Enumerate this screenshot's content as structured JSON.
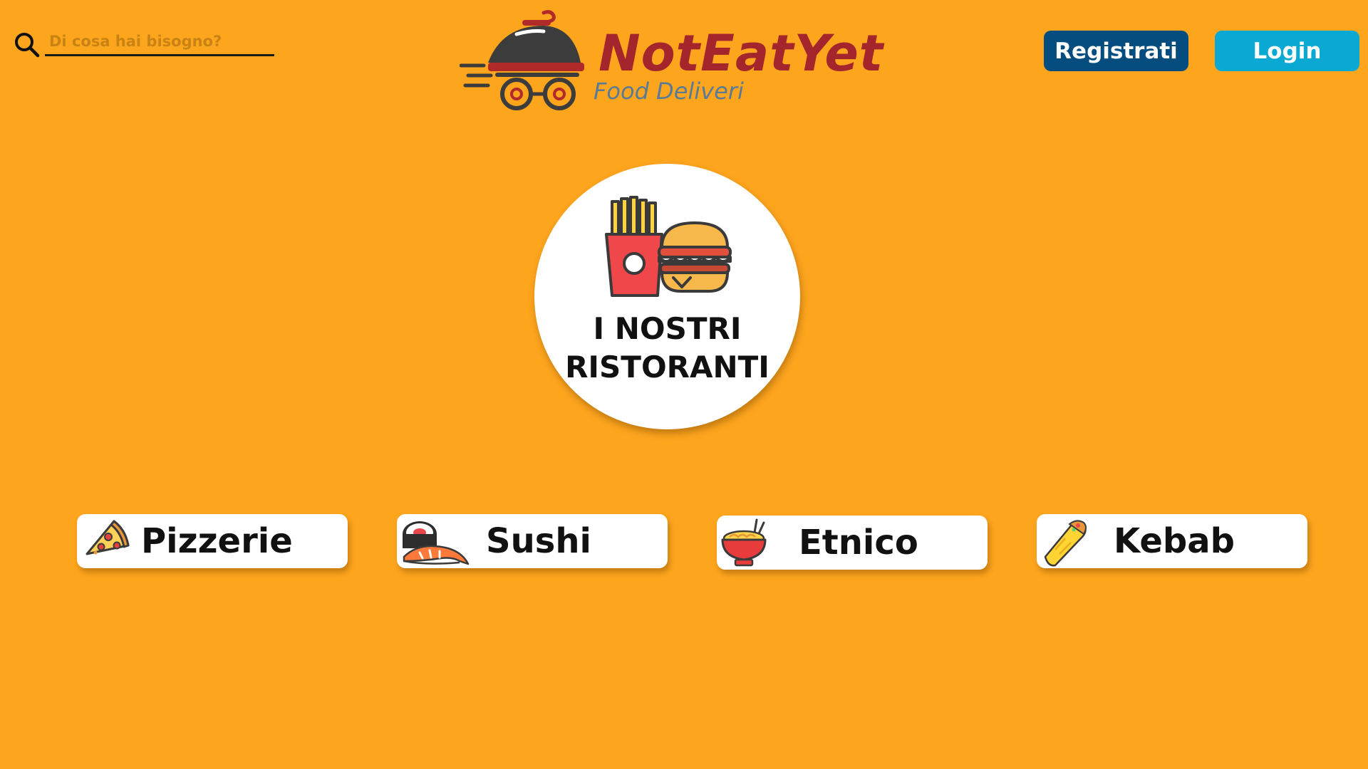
{
  "search": {
    "placeholder": "Di cosa hai bisogno?",
    "value": ""
  },
  "logo": {
    "title": "NotEatYet",
    "subtitle": "Food Deliveri"
  },
  "header": {
    "register_label": "Registrati",
    "login_label": "Login"
  },
  "hero": {
    "line1": "I NOSTRI",
    "line2": "RISTORANTI",
    "icon": "fries-burger-icon"
  },
  "categories": [
    {
      "label": "Pizzerie",
      "icon": "pizza-icon"
    },
    {
      "label": "Sushi",
      "icon": "sushi-icon"
    },
    {
      "label": "Etnico",
      "icon": "noodle-bowl-icon"
    },
    {
      "label": "Kebab",
      "icon": "kebab-wrap-icon"
    }
  ],
  "colors": {
    "background": "#fea51e",
    "brand_red": "#a4262c",
    "register_button": "#054d7f",
    "login_button": "#0aa9d4"
  }
}
